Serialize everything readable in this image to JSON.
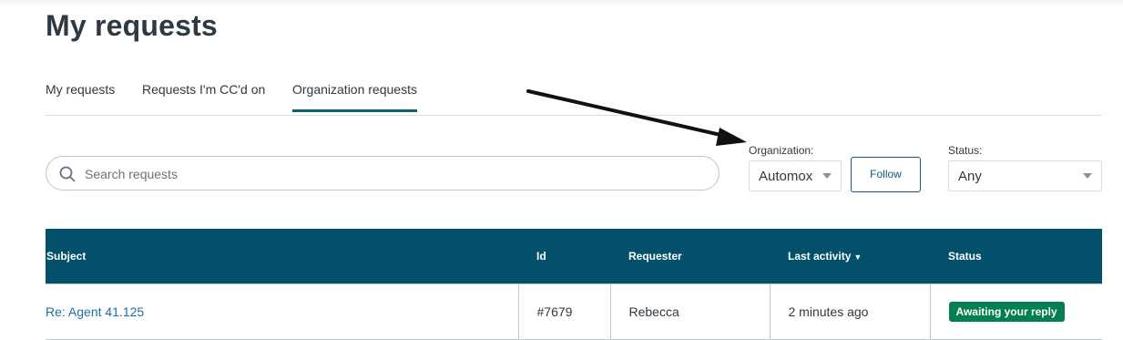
{
  "page": {
    "title": "My requests"
  },
  "tabs": [
    {
      "label": "My requests",
      "active": false
    },
    {
      "label": "Requests I'm CC'd on",
      "active": false
    },
    {
      "label": "Organization requests",
      "active": true
    }
  ],
  "search": {
    "placeholder": "Search requests",
    "value": "",
    "icon": "search-icon"
  },
  "filters": {
    "organization": {
      "label": "Organization:",
      "value": "Automox"
    },
    "follow_label": "Follow",
    "status": {
      "label": "Status:",
      "value": "Any"
    }
  },
  "table": {
    "columns": [
      "Subject",
      "Id",
      "Requester",
      "Last activity",
      "Status"
    ],
    "sort_indicator": "▼",
    "rows": [
      {
        "subject": "Re: Agent 41.125",
        "id": "#7679",
        "requester": "Rebecca",
        "last_activity": "2 minutes ago",
        "status": "Awaiting your reply"
      }
    ]
  },
  "colors": {
    "header_bg": "#03506b",
    "accent": "#0f5e76",
    "status_green": "#037f52"
  }
}
